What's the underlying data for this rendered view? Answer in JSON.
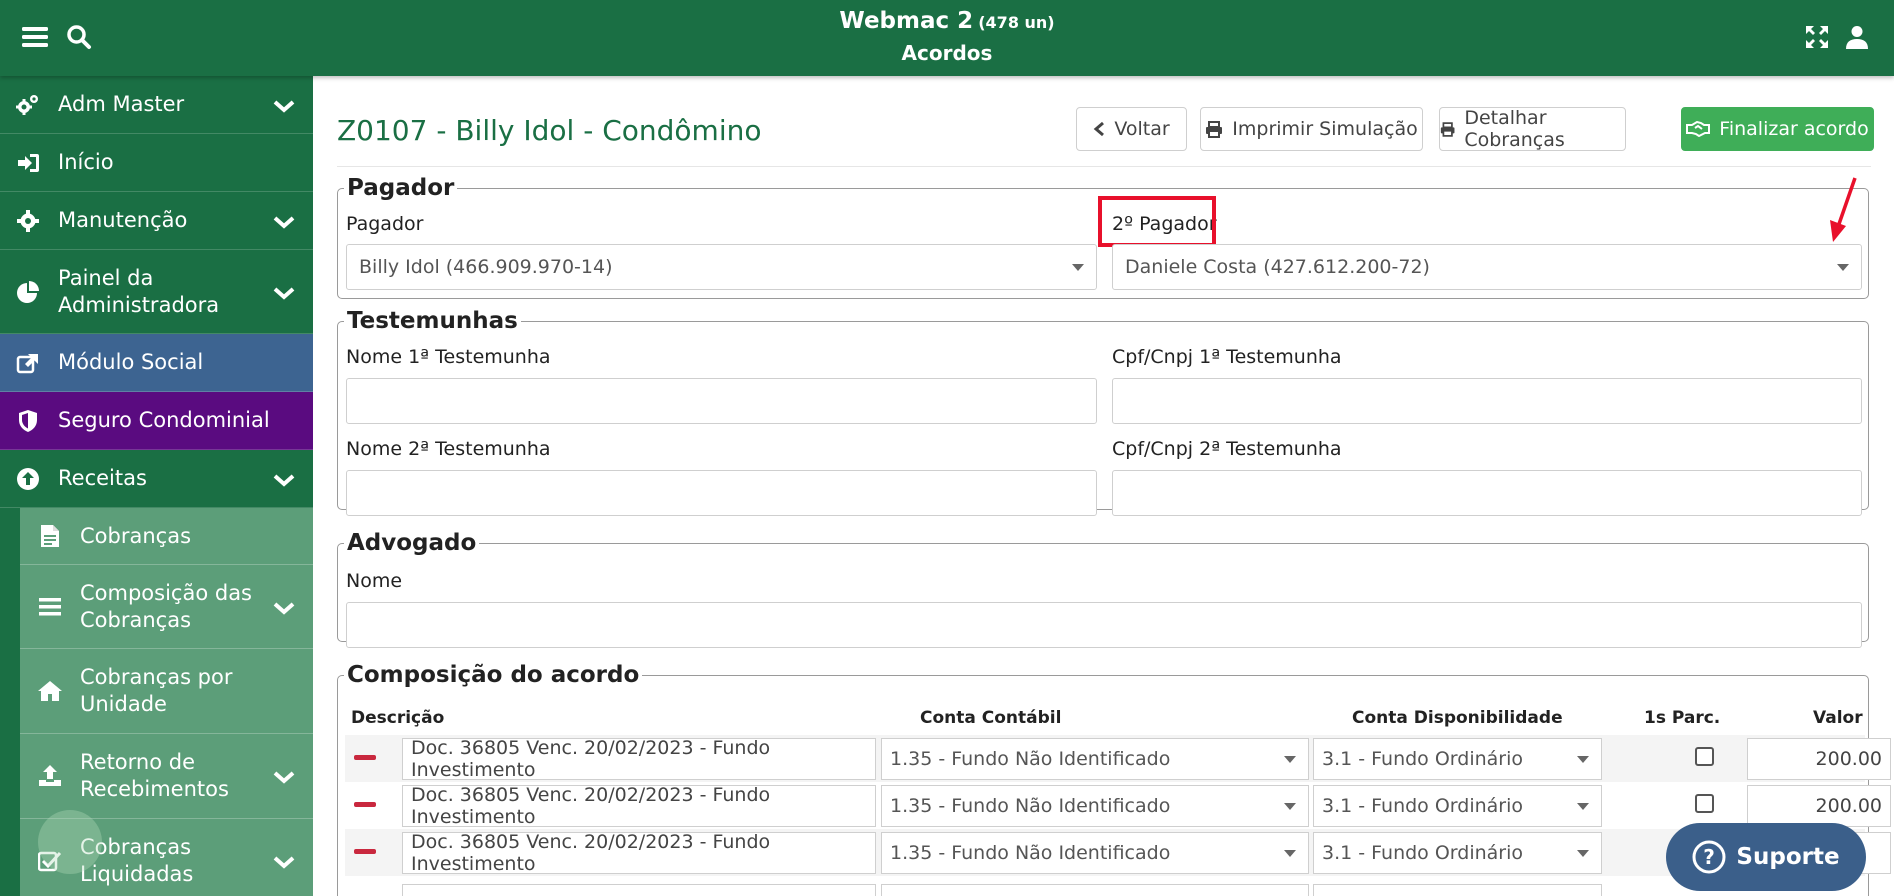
{
  "header": {
    "app_name": "Webmac 2",
    "units": "(478 un)",
    "page": "Acordos",
    "menu_icon": "hamburger-icon",
    "search_icon": "search-icon",
    "expand_icon": "expand-icon",
    "user_icon": "user-icon"
  },
  "sidebar": {
    "items": [
      {
        "label": "Adm Master",
        "icon": "gears-icon",
        "expandable": true
      },
      {
        "label": "Início",
        "icon": "sign-in-icon",
        "expandable": false
      },
      {
        "label": "Manutenção",
        "icon": "gear-icon",
        "expandable": true
      },
      {
        "label": "Painel da Administradora",
        "icon": "pie-chart-icon",
        "expandable": true
      },
      {
        "label": "Módulo Social",
        "icon": "external-link-icon",
        "expandable": false
      },
      {
        "label": "Seguro Condominial",
        "icon": "shield-icon",
        "expandable": false
      },
      {
        "label": "Receitas",
        "icon": "arrow-up-circle-icon",
        "expandable": true
      }
    ],
    "sub_items": [
      {
        "label": "Cobranças",
        "icon": "file-icon",
        "expandable": false
      },
      {
        "label": "Composição das Cobranças",
        "icon": "list-icon",
        "expandable": true
      },
      {
        "label": "Cobranças por Unidade",
        "icon": "home-icon",
        "expandable": false
      },
      {
        "label": "Retorno de Recebimentos",
        "icon": "upload-icon",
        "expandable": true
      },
      {
        "label": "Cobranças Liquidadas",
        "icon": "check-square-icon",
        "expandable": true
      }
    ]
  },
  "main": {
    "title": "Z0107 - Billy Idol - Condômino",
    "buttons": {
      "voltar": "Voltar",
      "imprimir": "Imprimir Simulação",
      "detalhar": "Detalhar Cobranças",
      "finalizar": "Finalizar acordo"
    },
    "pagador": {
      "legend": "Pagador",
      "label1": "Pagador",
      "value1": "Billy Idol (466.909.970-14)",
      "label2": "2º Pagador",
      "value2": "Daniele Costa (427.612.200-72)"
    },
    "testemunhas": {
      "legend": "Testemunhas",
      "nome1": "Nome 1ª Testemunha",
      "cpf1": "Cpf/Cnpj 1ª Testemunha",
      "nome2": "Nome 2ª Testemunha",
      "cpf2": "Cpf/Cnpj 2ª Testemunha"
    },
    "advogado": {
      "legend": "Advogado",
      "nome": "Nome"
    },
    "composicao": {
      "legend": "Composição do acordo",
      "headers": [
        "Descrição",
        "Conta Contábil",
        "Conta Disponibilidade",
        "1s Parc.",
        "Valor"
      ],
      "rows": [
        {
          "descricao": "Doc. 36805 Venc. 20/02/2023 - Fundo Investimento",
          "conta": "1.35 - Fundo Não Identificado",
          "disp": "3.1 - Fundo Ordinário",
          "parc": false,
          "valor": "200.00"
        },
        {
          "descricao": "Doc. 36805 Venc. 20/02/2023 - Fundo Investimento",
          "conta": "1.35 - Fundo Não Identificado",
          "disp": "3.1 - Fundo Ordinário",
          "parc": false,
          "valor": "200.00"
        },
        {
          "descricao": "Doc. 36805 Venc. 20/02/2023 - Fundo Investimento",
          "conta": "1.35 - Fundo Não Identificado",
          "disp": "3.1 - Fundo Ordinário",
          "parc": false,
          "valor": ""
        }
      ]
    }
  },
  "support": {
    "label": "Suporte",
    "icon": "question-circle-icon"
  },
  "colors": {
    "header_green": "#1a6f44",
    "submenu_green": "#5c9e79",
    "social_blue": "#3d6491",
    "seguro_purple": "#5a0b80",
    "finalizar_green": "#3fae58",
    "annotation_red": "#e8102b",
    "support_blue": "#3b5f8a"
  }
}
